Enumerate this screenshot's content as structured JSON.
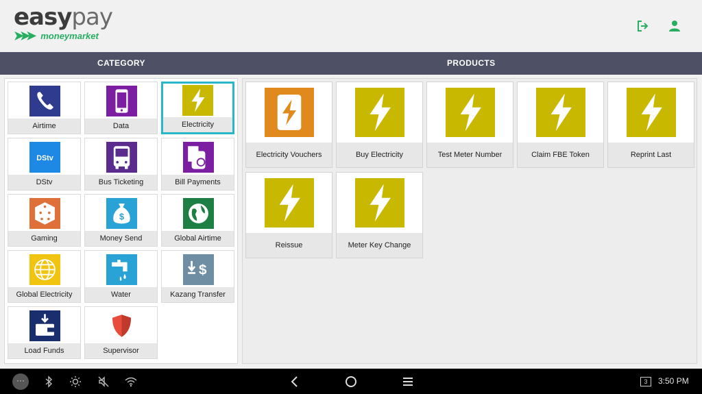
{
  "header": {
    "logo_main_bold": "easy",
    "logo_main_thin": "pay",
    "logo_sub": "moneymarket",
    "icons": [
      "logout-icon",
      "user-icon"
    ],
    "accent": "#27ae60"
  },
  "columns": {
    "category": "CATEGORY",
    "products": "PRODUCTS",
    "bar_color": "#4e5066"
  },
  "categories": [
    {
      "label": "Airtime",
      "icon": "phone-icon",
      "color": "#2e3b8f"
    },
    {
      "label": "Data",
      "icon": "mobile-icon",
      "color": "#7b1ea2"
    },
    {
      "label": "Electricity",
      "icon": "lightning-icon",
      "color": "#c9b800",
      "active": true
    },
    {
      "label": "DStv",
      "icon": "dstv-icon",
      "color": "#1e88e5"
    },
    {
      "label": "Bus Ticketing",
      "icon": "bus-icon",
      "color": "#5b2c8e"
    },
    {
      "label": "Bill Payments",
      "icon": "bill-icon",
      "color": "#7b1ea2"
    },
    {
      "label": "Gaming",
      "icon": "dice-icon",
      "color": "#e0703a"
    },
    {
      "label": "Money Send",
      "icon": "money-bag-icon",
      "color": "#29a3d6"
    },
    {
      "label": "Global Airtime",
      "icon": "globe-icon",
      "color": "#1d7f43"
    },
    {
      "label": "Global Electricity",
      "icon": "globe-lightning-icon",
      "color": "#f1c40f"
    },
    {
      "label": "Water",
      "icon": "tap-icon",
      "color": "#29a3d6"
    },
    {
      "label": "Kazang Transfer",
      "icon": "transfer-icon",
      "color": "#6f8ea3"
    },
    {
      "label": "Load Funds",
      "icon": "wallet-icon",
      "color": "#1a2e6e"
    },
    {
      "label": "Supervisor",
      "icon": "shield-icon",
      "color": "#e74c3c"
    }
  ],
  "products": [
    {
      "label": "Electricity Vouchers",
      "icon": "voucher-lightning-icon",
      "color": "#e08a1e"
    },
    {
      "label": "Buy Electricity",
      "icon": "lightning-icon",
      "color": "#c9b800"
    },
    {
      "label": "Test Meter Number",
      "icon": "lightning-icon",
      "color": "#c9b800"
    },
    {
      "label": "Claim FBE Token",
      "icon": "lightning-icon",
      "color": "#c9b800"
    },
    {
      "label": "Reprint Last",
      "icon": "lightning-icon",
      "color": "#c9b800"
    },
    {
      "label": "Reissue",
      "icon": "lightning-icon",
      "color": "#c9b800"
    },
    {
      "label": "Meter Key Change",
      "icon": "lightning-icon",
      "color": "#c9b800"
    }
  ],
  "system_bar": {
    "menu_label": "···",
    "badge": "3",
    "time": "3:50 PM"
  }
}
